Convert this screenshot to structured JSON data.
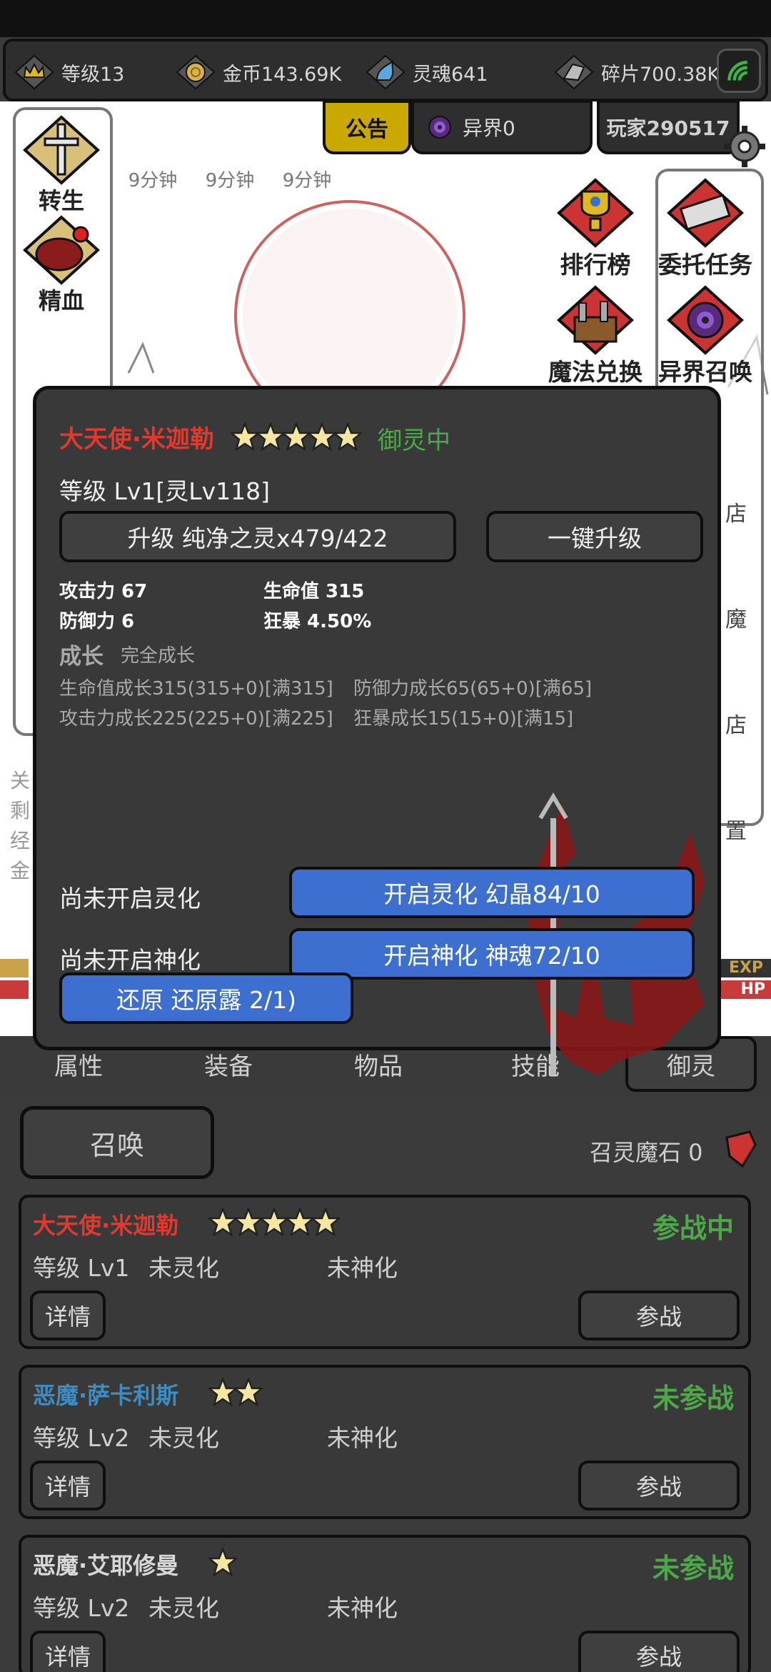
{
  "resources": [
    {
      "icon": "crown-icon",
      "text": "等级13"
    },
    {
      "icon": "gold-coin-icon",
      "text": "金币143.69K"
    },
    {
      "icon": "soul-icon",
      "text": "灵魂641"
    },
    {
      "icon": "fragment-icon",
      "text": "碎片700.38K"
    }
  ],
  "top_tabs": {
    "notice": "公告",
    "otherworld": "异界0",
    "player": "玩家290517"
  },
  "timers": [
    "9分钟",
    "9分钟",
    "9分钟"
  ],
  "left_menu": [
    {
      "icon": "rebirth-sword-icon",
      "label": "转生"
    },
    {
      "icon": "essence-blood-icon",
      "label": "精血"
    }
  ],
  "right_menu": [
    {
      "icon": "leaderboard-trophy-icon",
      "label": "排行榜"
    },
    {
      "icon": "commission-scroll-icon",
      "label": "委托任务"
    },
    {
      "icon": "magic-exchange-chest-icon",
      "label": "魔法兑换"
    },
    {
      "icon": "otherworld-portal-icon",
      "label": "异界召唤"
    }
  ],
  "scene_left_texts": [
    "关",
    "剩",
    "经",
    "金"
  ],
  "scene_right_texts": [
    "店",
    "魔",
    "店",
    "置"
  ],
  "bars": {
    "exp": "EXP",
    "hp": "HP"
  },
  "dialog": {
    "name": "大天使·米迦勒",
    "stars": 5,
    "state": "御灵中",
    "level": "等级 Lv1[灵Lv118]",
    "upgrade_btn": "升级 纯净之灵x479/422",
    "oneclick_btn": "一键升级",
    "stats": {
      "atk": "攻击力 67",
      "hp": "生命值 315",
      "def": "防御力 6",
      "crit": "狂暴 4.50%"
    },
    "growth_title": "成长",
    "growth_sub": "完全成长",
    "growth_lines": {
      "hp": "生命值成长315(315+0)[满315]",
      "def": "防御力成长65(65+0)[满65]",
      "atk": "攻击力成长225(225+0)[满225]",
      "crit": "狂暴成长15(15+0)[满15]"
    },
    "spirit_label": "尚未开启灵化",
    "spirit_btn": "开启灵化 幻晶84/10",
    "divine_label": "尚未开启神化",
    "divine_btn": "开启神化 神魂72/10",
    "restore_btn": "还原 还原露 2/1)"
  },
  "tabs": [
    "属性",
    "装备",
    "物品",
    "技能",
    "御灵"
  ],
  "summon": {
    "button": "召唤",
    "stone": "召灵魔石 0"
  },
  "cards": [
    {
      "name": "大天使·米迦勒",
      "name_color": "#e2392f",
      "stars": 5,
      "status": "参战中",
      "level": "等级 Lv1",
      "spirit": "未灵化",
      "divine": "未神化",
      "detail": "详情",
      "join": "参战"
    },
    {
      "name": "恶魔·萨卡利斯",
      "name_color": "#3d8cc4",
      "stars": 2,
      "status": "未参战",
      "level": "等级 Lv2",
      "spirit": "未灵化",
      "divine": "未神化",
      "detail": "详情",
      "join": "参战"
    },
    {
      "name": "恶魔·艾耶修曼",
      "name_color": "#d8d8d8",
      "stars": 1,
      "status": "未参战",
      "level": "等级 Lv2",
      "spirit": "未灵化",
      "divine": "未神化",
      "detail": "详情",
      "join": "参战"
    }
  ],
  "colors": {
    "dialog_name": "#e2392f",
    "dialog_state": "#4ea84a",
    "blue_button": "#3c6fd0",
    "status_green": "#4ea84a",
    "notice_tab": "#c9a800"
  }
}
